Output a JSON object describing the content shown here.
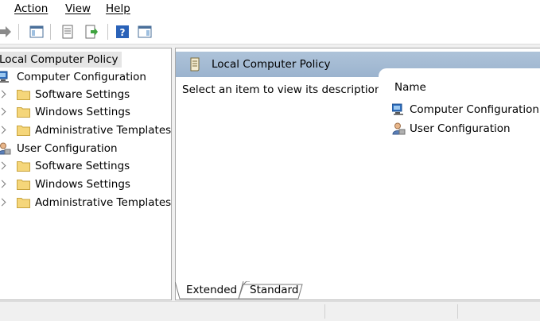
{
  "menu": {
    "items": [
      {
        "label": "Action"
      },
      {
        "label": "View"
      },
      {
        "label": "Help"
      }
    ]
  },
  "toolbar": {
    "icons": [
      "forward-arrow-icon",
      "show-hide-tree-icon",
      "properties-icon",
      "export-list-icon",
      "help-icon",
      "show-hide-action-pane-icon"
    ]
  },
  "tree": {
    "root": {
      "label": "Local Computer Policy"
    },
    "nodes": [
      {
        "label": "Computer Configuration",
        "icon": "computer-icon"
      },
      {
        "label": "Software Settings",
        "icon": "folder-icon"
      },
      {
        "label": "Windows Settings",
        "icon": "folder-icon"
      },
      {
        "label": "Administrative Templates",
        "icon": "folder-icon"
      },
      {
        "label": "User Configuration",
        "icon": "user-icon"
      },
      {
        "label": "Software Settings",
        "icon": "folder-icon"
      },
      {
        "label": "Windows Settings",
        "icon": "folder-icon"
      },
      {
        "label": "Administrative Templates",
        "icon": "folder-icon"
      }
    ]
  },
  "details": {
    "header_title": "Local Computer Policy",
    "description": "Select an item to view its description.",
    "column_name": "Name",
    "items": [
      {
        "label": "Computer Configuration",
        "icon": "computer-icon"
      },
      {
        "label": "User Configuration",
        "icon": "user-icon"
      }
    ]
  },
  "tabs": [
    {
      "label": "Extended",
      "active": true
    },
    {
      "label": "Standard",
      "active": false
    }
  ],
  "colors": {
    "header_blue": "#9bb3ce",
    "folder_yellow": "#f5d67a",
    "selection_gray": "#e5e5e5"
  }
}
